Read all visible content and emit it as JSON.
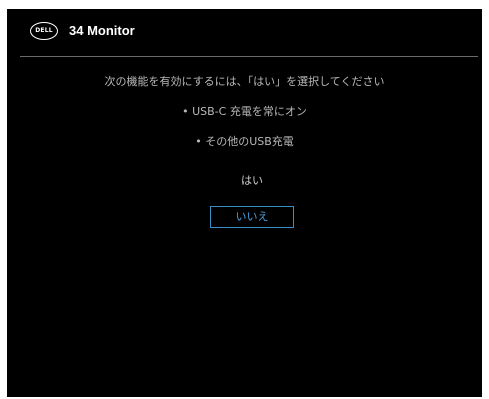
{
  "header": {
    "logo_text": "DELL",
    "title": "34 Monitor"
  },
  "message": "次の機能を有効にするには、「はい」を選択してください",
  "features": [
    "• USB-C 充電を常にオン",
    "• その他のUSB充電"
  ],
  "options": {
    "yes_label": "はい",
    "no_label": "いいえ",
    "selected": "no"
  },
  "colors": {
    "background": "#000000",
    "accent": "#3a8ec8",
    "text": "#b8b8b8"
  }
}
